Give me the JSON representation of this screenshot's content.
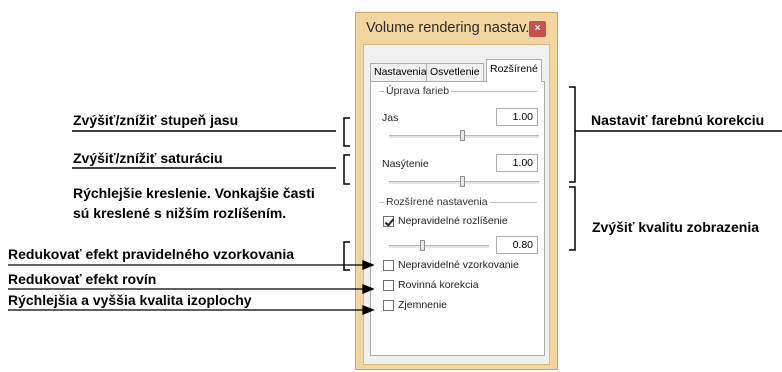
{
  "window": {
    "title": "Volume rendering nastav...",
    "close_glyph": "×"
  },
  "tabs": [
    {
      "label": "Nastavenia",
      "active": false
    },
    {
      "label": "Osvetlenie",
      "active": false
    },
    {
      "label": "Rozšírené",
      "active": true
    }
  ],
  "color_group": {
    "title": "Úprava farieb",
    "brightness": {
      "label": "Jas",
      "value": "1.00",
      "slider_fraction": 0.5
    },
    "saturation": {
      "label": "Nasýtenie",
      "value": "1.00",
      "slider_fraction": 0.5
    }
  },
  "advanced_group": {
    "title": "Rozšírené nastavenia",
    "irregular_resolution": {
      "label": "Nepravidelné rozlíšenie",
      "checked": true,
      "value": "0.80",
      "slider_fraction": 0.3
    },
    "irregular_sampling": {
      "label": "Nepravidelné vzorkovanie",
      "checked": false
    },
    "plane_correction": {
      "label": "Rovinná korekcia",
      "checked": false
    },
    "smoothing": {
      "label": "Zjemnenie",
      "checked": false
    }
  },
  "annotations": {
    "brightness": "Zvýšiť/znížiť stupeň jasu",
    "saturation": "Zvýšiť/znížiť saturáciu",
    "faster_line1": "Rýchlejšie kreslenie. Vonkajšie časti",
    "faster_line2": "sú kreslené s nižším rozlíšením.",
    "sampling": "Redukovať efekt pravidelného vzorkovania",
    "planes": "Redukovať efekt rovín",
    "isosurface": "Rýchlejšia a vyššia kvalita izoplochy",
    "color_correction": "Nastaviť farebnú korekciu",
    "quality": "Zvýšiť kvalitu zobrazenia"
  },
  "colors": {
    "window_frame": "#f3d69f",
    "close_button": "#c75050"
  }
}
